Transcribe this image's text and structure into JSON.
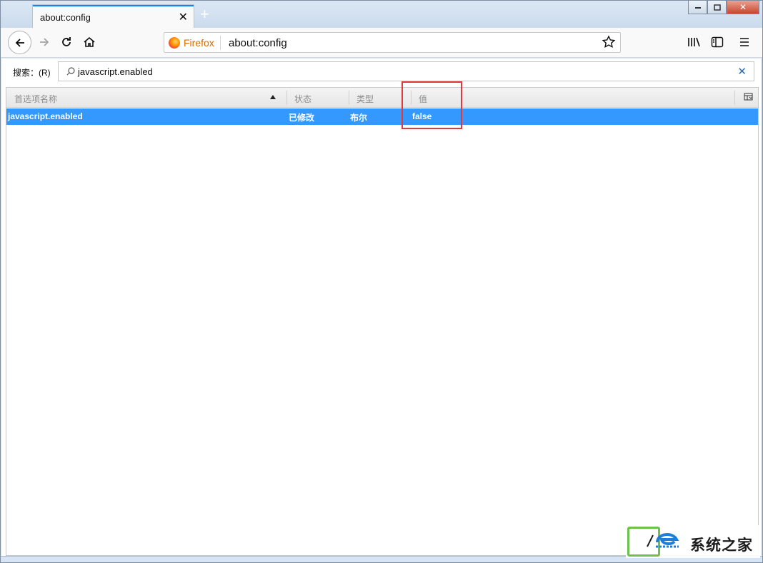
{
  "tab": {
    "title": "about:config",
    "close": "✕",
    "new_tab": "+"
  },
  "window_controls": {
    "minimize": "▭",
    "maximize": "◻",
    "close": "✕"
  },
  "navbar": {
    "identity_label": "Firefox",
    "url": "about:config"
  },
  "search": {
    "label": "搜索：(R)",
    "value": "javascript.enabled",
    "clear": "✕"
  },
  "table": {
    "columns": [
      "首选项名称",
      "状态",
      "类型",
      "值"
    ],
    "rows": [
      {
        "name": "javascript.enabled",
        "status": "已修改",
        "type": "布尔",
        "value": "false"
      }
    ]
  },
  "watermark": {
    "text": "系统之家"
  },
  "colors": {
    "selection": "#3399ff",
    "highlight_box": "#e0393b",
    "tab_accent": "#0a84ff"
  }
}
